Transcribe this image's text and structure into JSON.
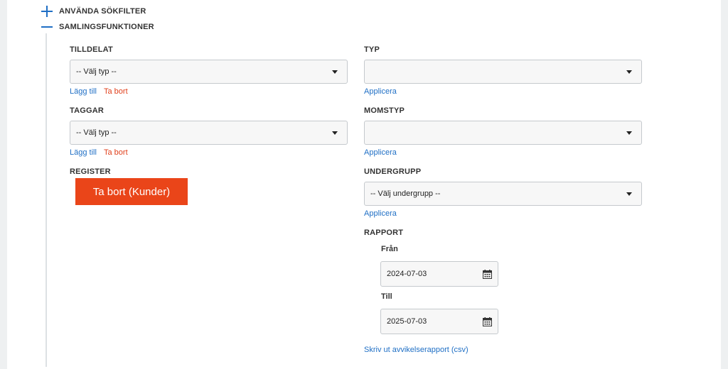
{
  "sections": {
    "filters_title": "ANVÄNDA SÖKFILTER",
    "collection_title": "SAMLINGSFUNKTIONER"
  },
  "tilldelat": {
    "label": "TILLDELAT",
    "select_value": "-- Välj typ --",
    "add": "Lägg till",
    "remove": "Ta bort"
  },
  "taggar": {
    "label": "TAGGAR",
    "select_value": "-- Välj typ --",
    "add": "Lägg till",
    "remove": "Ta bort"
  },
  "register": {
    "label": "REGISTER",
    "button": "Ta bort (Kunder)"
  },
  "typ": {
    "label": "TYP",
    "select_value": "",
    "apply": "Applicera"
  },
  "momstyp": {
    "label": "MOMSTYP",
    "select_value": "",
    "apply": "Applicera"
  },
  "undergrupp": {
    "label": "UNDERGRUPP",
    "select_value": "-- Välj undergrupp --",
    "apply": "Applicera"
  },
  "rapport": {
    "label": "RAPPORT",
    "from_label": "Från",
    "from_value": "2024-07-03",
    "to_label": "Till",
    "to_value": "2025-07-03",
    "print_link": "Skriv ut avvikelserapport (csv)"
  },
  "icons": {
    "expand": "plus-icon",
    "collapse": "minus-icon",
    "dropdown": "chevron-down-icon",
    "date": "calendar-icon"
  },
  "colors": {
    "accent": "#1f6fc5",
    "danger": "#ea4519",
    "danger_text": "#e0401c"
  }
}
